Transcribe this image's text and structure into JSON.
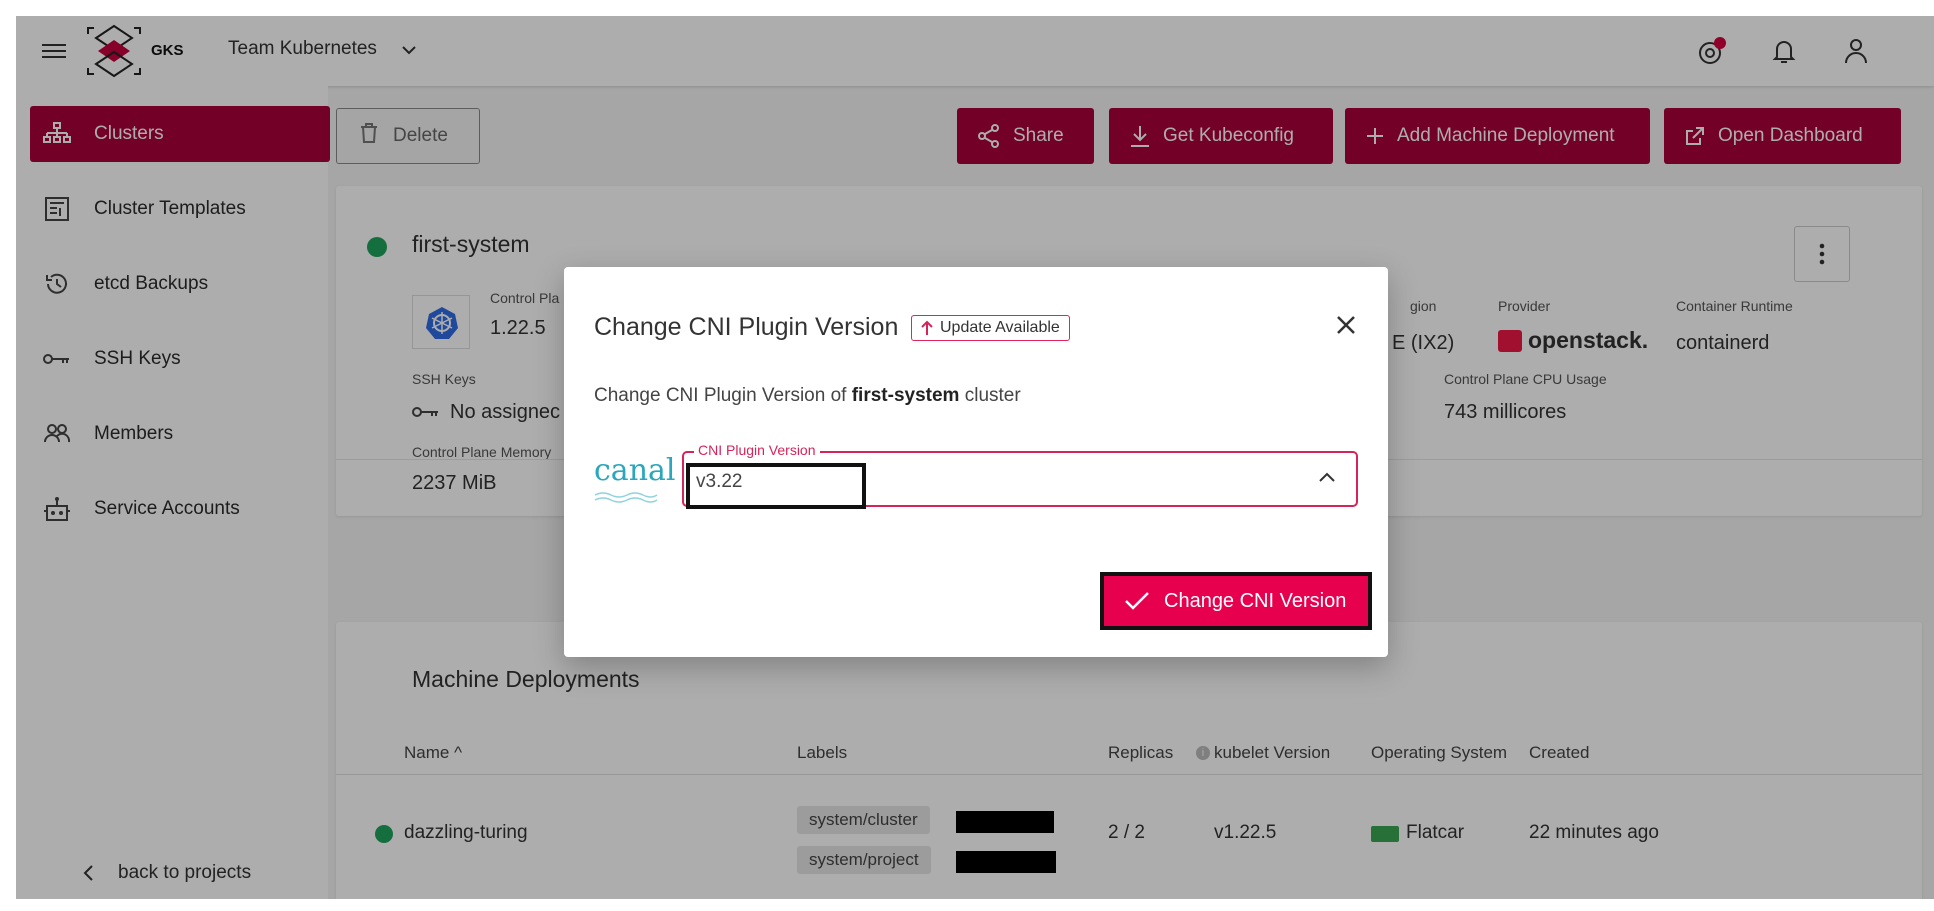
{
  "topbar": {
    "logo_text": "GKS",
    "team_name": "Team Kubernetes"
  },
  "sidebar": {
    "items": [
      {
        "label": "Clusters",
        "icon": "cluster-icon",
        "active": true
      },
      {
        "label": "Cluster Templates",
        "icon": "template-icon",
        "active": false
      },
      {
        "label": "etcd Backups",
        "icon": "history-icon",
        "active": false
      },
      {
        "label": "SSH Keys",
        "icon": "key-icon",
        "active": false
      },
      {
        "label": "Members",
        "icon": "members-icon",
        "active": false
      },
      {
        "label": "Service Accounts",
        "icon": "robot-icon",
        "active": false
      }
    ],
    "back_label": "back to projects"
  },
  "toolbar": {
    "delete_label": "Delete",
    "share_label": "Share",
    "kubeconfig_label": "Get Kubeconfig",
    "add_md_label": "Add Machine Deployment",
    "dashboard_label": "Open Dashboard"
  },
  "cluster": {
    "name": "first-system",
    "control_plane_label": "Control Pla",
    "control_plane_version": "1.22.5",
    "region_label": "gion",
    "region_value": "E (IX2)",
    "provider_label": "Provider",
    "provider_value": "openstack.",
    "runtime_label": "Container Runtime",
    "runtime_value": "containerd",
    "ssh_keys_label": "SSH Keys",
    "ssh_keys_value": "No assignec",
    "cpu_label": "Control Plane CPU Usage",
    "cpu_value": "743 millicores",
    "memory_label": "Control Plane Memory",
    "memory_value": "2237 MiB"
  },
  "machine_deployments": {
    "title": "Machine Deployments",
    "columns": [
      "Name",
      "Labels",
      "Replicas",
      "kubelet Version",
      "Operating System",
      "Created"
    ],
    "rows": [
      {
        "name": "dazzling-turing",
        "labels": [
          "system/cluster",
          "system/project"
        ],
        "replicas": "2 / 2",
        "kubelet": "v1.22.5",
        "os": "Flatcar",
        "created": "22 minutes ago"
      }
    ]
  },
  "dialog": {
    "title": "Change CNI Plugin Version",
    "badge": "Update Available",
    "subtitle_prefix": "Change CNI Plugin Version of ",
    "subtitle_cluster": "first-system",
    "subtitle_suffix": " cluster",
    "plugin_logo_text": "canal",
    "field_label": "CNI Plugin Version",
    "field_value": "v3.22",
    "submit_label": "Change CNI Version"
  },
  "colors": {
    "brand": "#a8003a",
    "accent": "#e6004e",
    "status_ok": "#1fa35a"
  }
}
